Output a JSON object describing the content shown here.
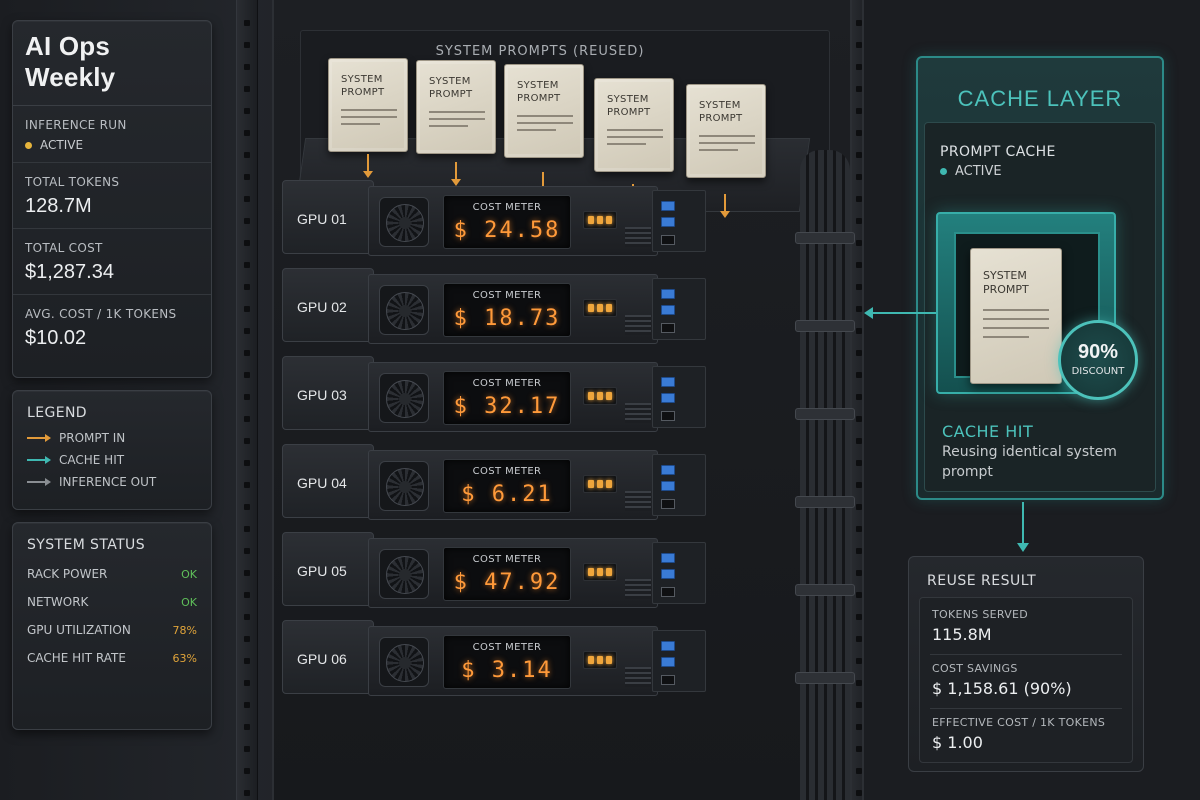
{
  "brand": "AI Ops Weekly",
  "metrics": {
    "run_label": "INFERENCE RUN",
    "run_status": "ACTIVE",
    "tokens_label": "TOTAL TOKENS",
    "tokens_value": "128.7M",
    "cost_label": "TOTAL COST",
    "cost_value": "$1,287.34",
    "avg_label": "AVG. COST / 1K TOKENS",
    "avg_value": "$10.02"
  },
  "legend": {
    "title": "LEGEND",
    "items": [
      {
        "label": "PROMPT IN",
        "color": "#e29a3a"
      },
      {
        "label": "CACHE HIT",
        "color": "#3fb8b1"
      },
      {
        "label": "INFERENCE OUT",
        "color": "#8a8e93"
      }
    ]
  },
  "system_status": {
    "title": "SYSTEM STATUS",
    "rows": [
      {
        "label": "RACK POWER",
        "value": "OK",
        "color": "#5fbf5a"
      },
      {
        "label": "NETWORK",
        "value": "OK",
        "color": "#5fbf5a"
      },
      {
        "label": "GPU UTILIZATION",
        "value": "78%",
        "color": "#e0a43a"
      },
      {
        "label": "CACHE HIT RATE",
        "value": "63%",
        "color": "#e0a43a"
      }
    ]
  },
  "prompts": {
    "shelf_label": "SYSTEM PROMPTS (REUSED)",
    "card_line1": "SYSTEM",
    "card_line2": "PROMPT"
  },
  "gpus": [
    {
      "name": "GPU 01",
      "meter_label": "COST METER",
      "cost": "$ 24.58"
    },
    {
      "name": "GPU 02",
      "meter_label": "COST METER",
      "cost": "$ 18.73"
    },
    {
      "name": "GPU 03",
      "meter_label": "COST METER",
      "cost": "$ 32.17"
    },
    {
      "name": "GPU 04",
      "meter_label": "COST METER",
      "cost": "$ 6.21"
    },
    {
      "name": "GPU 05",
      "meter_label": "COST METER",
      "cost": "$ 47.92"
    },
    {
      "name": "GPU 06",
      "meter_label": "COST METER",
      "cost": "$ 3.14"
    }
  ],
  "cache": {
    "title": "CACHE LAYER",
    "prompt_cache_label": "PROMPT CACHE",
    "prompt_cache_status": "ACTIVE",
    "card_line1": "SYSTEM",
    "card_line2": "PROMPT",
    "discount_pct": "90%",
    "discount_label": "DISCOUNT",
    "hit_title": "CACHE HIT",
    "hit_desc": "Reusing identical system prompt"
  },
  "reuse": {
    "title": "REUSE RESULT",
    "tokens_label": "TOKENS SERVED",
    "tokens_value": "115.8M",
    "savings_label": "COST SAVINGS",
    "savings_value": "$ 1,158.61 (90%)",
    "eff_label": "EFFECTIVE COST / 1K TOKENS",
    "eff_value": "$ 1.00"
  },
  "colors": {
    "accent_orange": "#e29a3a",
    "accent_teal": "#3fb8b1",
    "status_active": "#e6b43c",
    "cache_active": "#3fb8b1"
  }
}
